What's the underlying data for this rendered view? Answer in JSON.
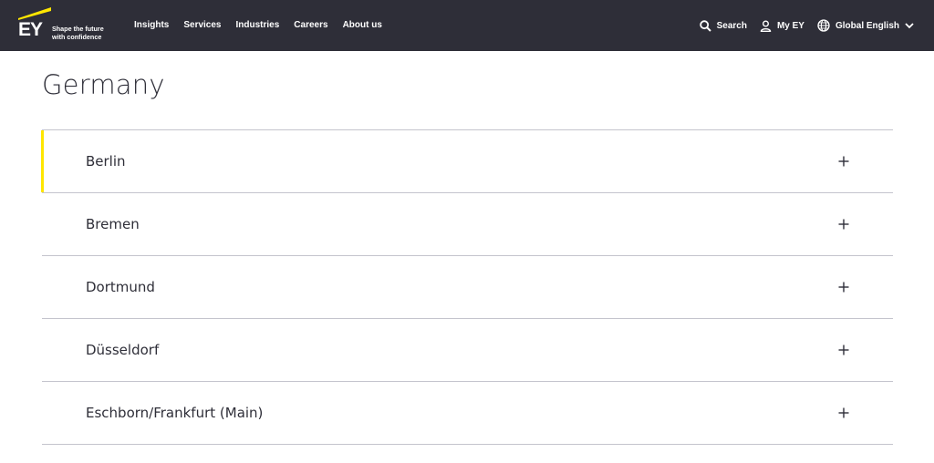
{
  "header": {
    "logo": {
      "brand": "EY",
      "tagline_line1": "Shape the future",
      "tagline_line2": "with confidence",
      "accent_color": "#ffe600"
    },
    "nav": [
      {
        "label": "Insights"
      },
      {
        "label": "Services"
      },
      {
        "label": "Industries"
      },
      {
        "label": "Careers"
      },
      {
        "label": "About us"
      }
    ],
    "utility": {
      "search_label": "Search",
      "search_icon": "search-icon",
      "account_label": "My EY",
      "account_icon": "user-icon",
      "language_label": "Global English",
      "language_icon": "globe-icon",
      "language_chevron": "chevron-down-icon"
    },
    "background_color": "#2e2e38"
  },
  "page": {
    "title": "Germany"
  },
  "accordion": {
    "items": [
      {
        "label": "Berlin",
        "active": true
      },
      {
        "label": "Bremen",
        "active": false
      },
      {
        "label": "Dortmund",
        "active": false
      },
      {
        "label": "Düsseldorf",
        "active": false
      },
      {
        "label": "Eschborn/Frankfurt (Main)",
        "active": false
      }
    ],
    "expand_icon": "plus-icon",
    "active_indicator_color": "#ffe600"
  }
}
